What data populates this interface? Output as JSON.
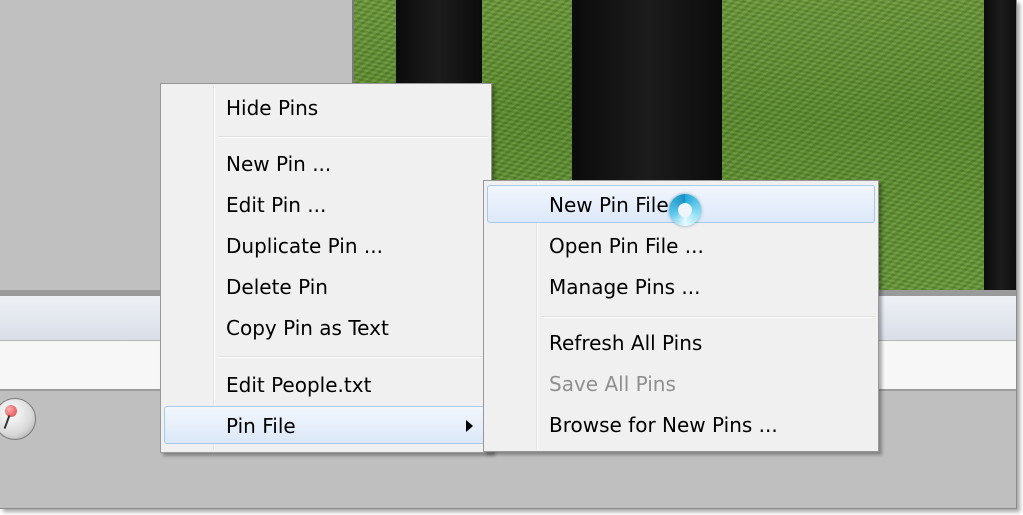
{
  "main_menu": {
    "items": [
      {
        "label": "Hide Pins",
        "enabled": true
      },
      {
        "label": "New Pin ...",
        "enabled": true
      },
      {
        "label": "Edit Pin ...",
        "enabled": true
      },
      {
        "label": "Duplicate Pin ...",
        "enabled": true
      },
      {
        "label": "Delete Pin",
        "enabled": true
      },
      {
        "label": "Copy Pin as Text",
        "enabled": true
      },
      {
        "label": "Edit People.txt",
        "enabled": true
      },
      {
        "label": "Pin File",
        "enabled": true,
        "has_submenu": true,
        "highlighted": true
      }
    ]
  },
  "pin_file_submenu": {
    "items": [
      {
        "label": "New Pin File ...",
        "enabled": true,
        "highlighted": true
      },
      {
        "label": "Open Pin File ...",
        "enabled": true
      },
      {
        "label": "Manage Pins ...",
        "enabled": true
      },
      {
        "label": "Refresh All Pins",
        "enabled": true
      },
      {
        "label": "Save All Pins",
        "enabled": false
      },
      {
        "label": "Browse for New Pins ...",
        "enabled": true
      }
    ]
  },
  "icons": {
    "pin": "pin-icon",
    "submenu_arrow": "chevron-right-icon",
    "cursor": "busy-cursor-icon"
  },
  "colors": {
    "menu_background": "#f0f0f0",
    "highlight_border": "#a8c8ec",
    "disabled_text": "#8f8f8f"
  }
}
